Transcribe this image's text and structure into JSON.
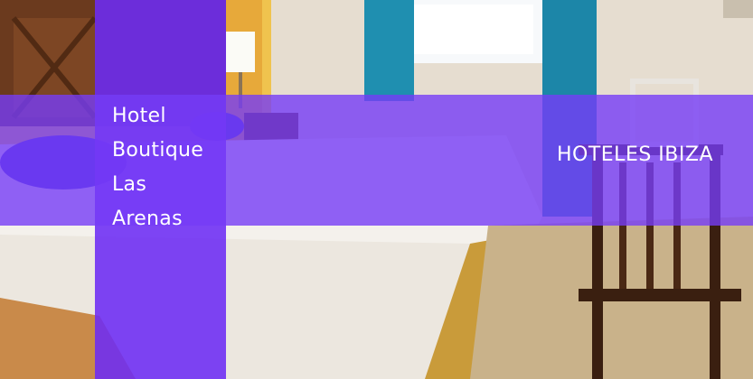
{
  "banner": {
    "hotel_name_lines": [
      "Hotel",
      "Boutique",
      "Las",
      "Arenas"
    ],
    "category": "HOTELES IBIZA"
  },
  "photo": {
    "subject": "hotel-bedroom-photo",
    "overlay_color": "#6c2bf5"
  }
}
